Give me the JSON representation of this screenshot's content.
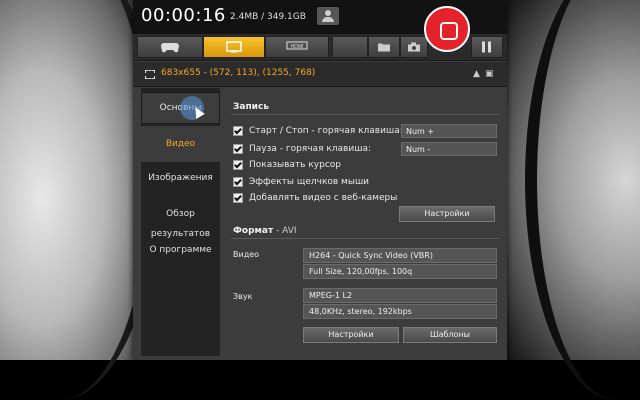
{
  "topbar": {
    "timer": "00:00:16",
    "file_size": "2.4MB / 349.1GB"
  },
  "toolbar": {
    "modes": [
      "game-mode",
      "screen-mode",
      "hdmi-device-mode"
    ],
    "active_mode": "screen-mode",
    "hdmi_label": "HDMI"
  },
  "region": {
    "text": "683x655 - (572, 113), (1255, 768)",
    "collapse_glyph": "▲",
    "window_glyph": "▣"
  },
  "nav": {
    "items": [
      "Основны",
      "Видео",
      "Изображения",
      "Обзор результатов",
      "О программе"
    ],
    "selected": "Видео"
  },
  "recording": {
    "title": "Запись",
    "options": [
      {
        "label": "Старт / Стоп - горячая клавиша:",
        "checked": true,
        "hotkey": "Num +"
      },
      {
        "label": "Пауза - горячая клавиша:",
        "checked": true,
        "hotkey": "Num -"
      },
      {
        "label": "Показывать курсор",
        "checked": true
      },
      {
        "label": "Эффекты щелчков мыши",
        "checked": true
      },
      {
        "label": "Добавлять видео с веб-камеры",
        "checked": true
      }
    ],
    "settings_button": "Настройки"
  },
  "format": {
    "title_prefix": "Формат",
    "title_suffix": " - AVI",
    "video_label": "Видео",
    "video_codec": "H264 - Quick Sync Video (VBR)",
    "video_details": "Full Size, 120,00fps, 100q",
    "audio_label": "Звук",
    "audio_codec": "MPEG-1 L2",
    "audio_details": "48,0KHz, stereo, 192kbps",
    "settings_button": "Настройки",
    "templates_button": "Шаблоны"
  },
  "colors": {
    "accent": "#f5a623",
    "record": "#e3222a"
  }
}
